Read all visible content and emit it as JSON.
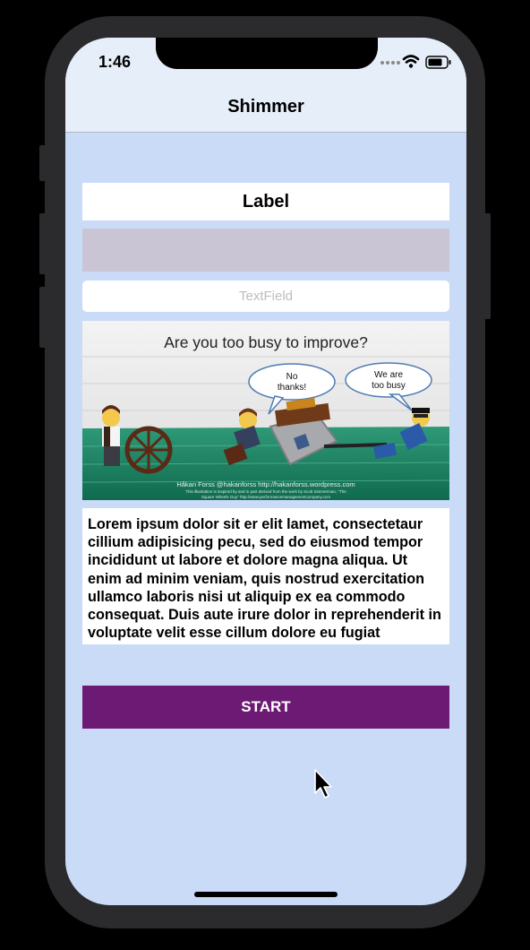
{
  "status_bar": {
    "time": "1:46",
    "signal_icon": "signal-dots-icon",
    "wifi_icon": "wifi-icon",
    "battery_icon": "battery-icon"
  },
  "nav": {
    "title": "Shimmer"
  },
  "content": {
    "label": "Label",
    "textfield_placeholder": "TextField",
    "image": {
      "title": "Are you too busy to improve?",
      "bubble_left": [
        "No",
        "thanks!"
      ],
      "bubble_right": [
        "We are",
        "too busy"
      ],
      "credit": "Håkan Forss @hakanforss http://hakanforss.wordpress.com",
      "fine_print_1": "This illustration is inspired by and in part derived from the work by Scott Simmerman, \"The",
      "fine_print_2": "Square Wheels Guy\" http://www.performancemanagementcompany.com"
    },
    "body_text": "Lorem ipsum dolor sit er elit lamet, consectetaur cillium adipisicing pecu, sed do eiusmod tempor incididunt ut labore et dolore magna aliqua. Ut enim ad minim veniam, quis nostrud exercitation ullamco laboris nisi ut aliquip ex ea commodo consequat. Duis aute irure dolor in reprehenderit in voluptate velit esse cillum dolore eu fugiat",
    "start_button_label": "START"
  },
  "colors": {
    "background": "#c9dbf6",
    "nav_background": "#e6eef9",
    "shimmer": "#c9c5d4",
    "button": "#6c1a73"
  }
}
